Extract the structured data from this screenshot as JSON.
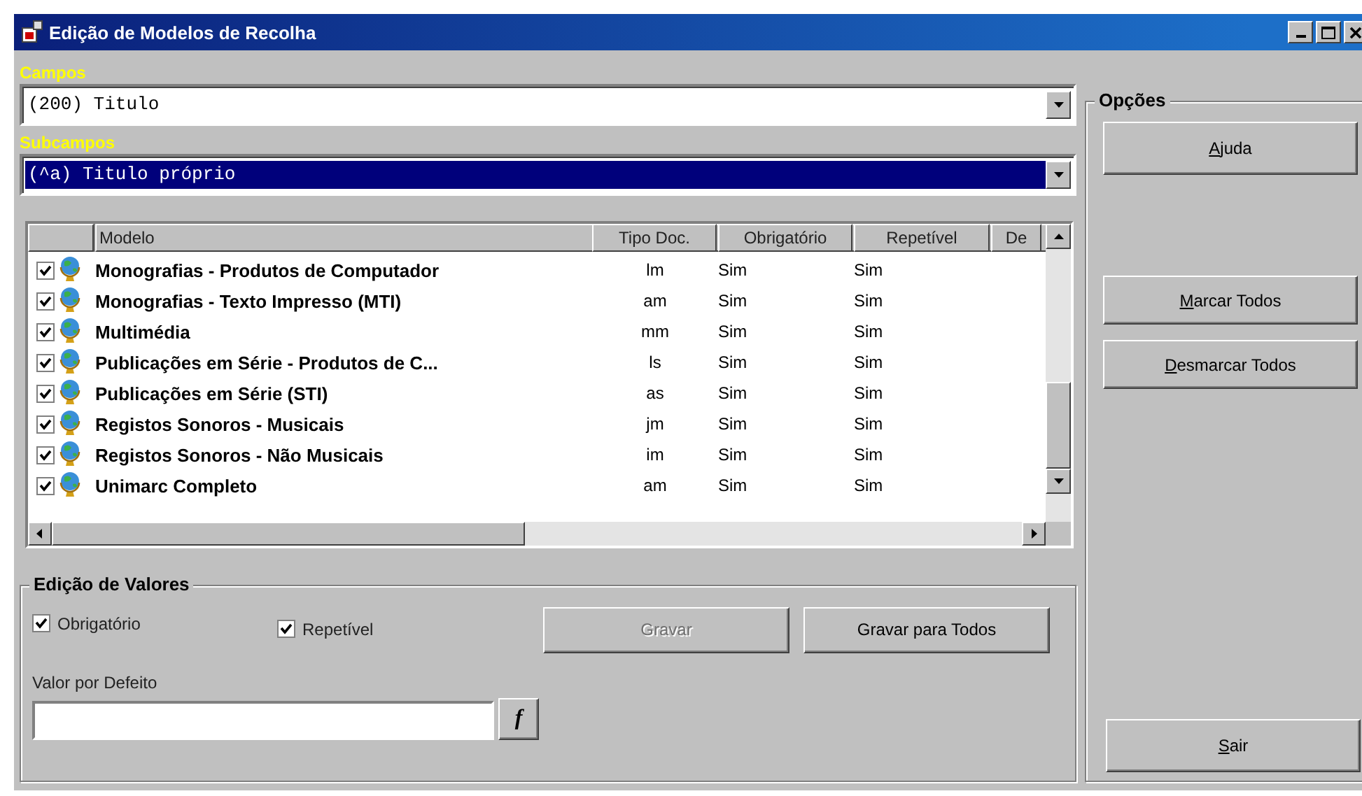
{
  "window": {
    "title": "Edição de Modelos de Recolha"
  },
  "campos": {
    "label": "Campos",
    "value": "(200) Titulo"
  },
  "subcampos": {
    "label": "Subcampos",
    "value": "(^a) Titulo próprio",
    "selected": true
  },
  "table": {
    "columns": [
      "Modelo",
      "Tipo Doc.",
      "Obrigatório",
      "Repetível",
      "De"
    ],
    "rows": [
      {
        "checked": true,
        "cells": [
          "Monografias - Produtos de Computador",
          "lm",
          "Sim",
          "Sim"
        ]
      },
      {
        "checked": true,
        "cells": [
          "Monografias - Texto Impresso  (MTI)",
          "am",
          "Sim",
          "Sim"
        ]
      },
      {
        "checked": true,
        "cells": [
          "Multimédia",
          "mm",
          "Sim",
          "Sim"
        ]
      },
      {
        "checked": true,
        "cells": [
          "Publicações em Série - Produtos de C...",
          "ls",
          "Sim",
          "Sim"
        ]
      },
      {
        "checked": true,
        "cells": [
          "Publicações em Série (STI)",
          "as",
          "Sim",
          "Sim"
        ]
      },
      {
        "checked": true,
        "cells": [
          "Registos Sonoros - Musicais",
          "jm",
          "Sim",
          "Sim"
        ]
      },
      {
        "checked": true,
        "cells": [
          "Registos Sonoros - Não Musicais",
          "im",
          "Sim",
          "Sim"
        ]
      },
      {
        "checked": true,
        "cells": [
          "Unimarc Completo",
          "am",
          "Sim",
          "Sim"
        ]
      }
    ]
  },
  "edicao": {
    "title": "Edição de Valores",
    "checkboxes": [
      {
        "label": "Obrigatório",
        "checked": true
      },
      {
        "label": "Repetível",
        "checked": true
      }
    ],
    "buttons": [
      {
        "label": "Gravar",
        "disabled": true
      },
      {
        "label": "Gravar para Todos",
        "disabled": false
      }
    ],
    "default_label": "Valor por Defeito",
    "function_button": "f"
  },
  "opcoes": {
    "title": "Opções",
    "buttons": [
      {
        "label": "Ajuda"
      },
      {
        "label": "Marcar Todos"
      },
      {
        "label": "Desmarcar Todos"
      },
      {
        "label": "Sair"
      }
    ]
  }
}
